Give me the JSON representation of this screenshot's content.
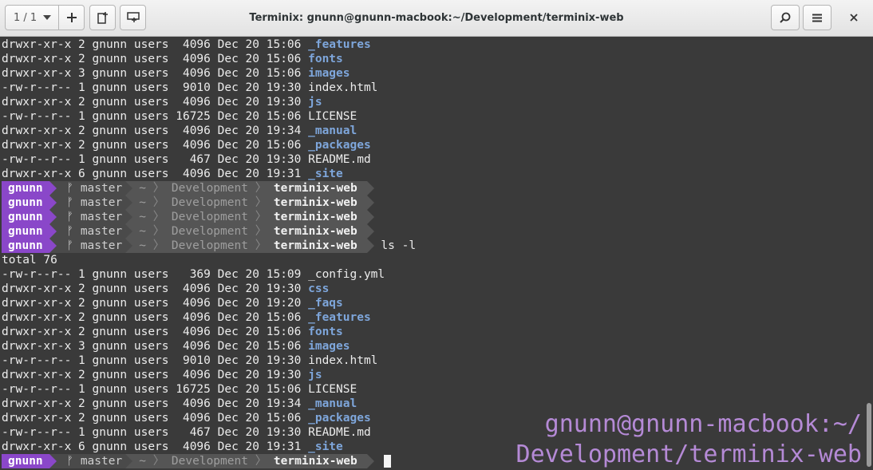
{
  "window": {
    "title": "Terminix: gnunn@gnunn-macbook:~/Development/terminix-web",
    "session_label": "1 / 1"
  },
  "icons": {
    "add": "plus-icon",
    "split_horizontal": "split-right-icon",
    "split_vertical": "split-down-icon",
    "find": "search-icon",
    "menu": "hamburger-icon",
    "close": "close-icon"
  },
  "colors": {
    "user_segment": "#8a47c9",
    "directory": "#7ea6db",
    "badge": "#b58ad6",
    "background": "#3a3a3a"
  },
  "prompt": {
    "user": "gnunn",
    "branch_icon": "ᚠ",
    "branch": "master",
    "home": "~",
    "dir1": "Development",
    "dir2": "terminix-web",
    "separator": "〉"
  },
  "terminal": {
    "lines_top": [
      {
        "meta": "drwxr-xr-x 2 gnunn users  4096 Dec 20 15:06 ",
        "name": "_features",
        "dir": true
      },
      {
        "meta": "drwxr-xr-x 2 gnunn users  4096 Dec 20 15:06 ",
        "name": "fonts",
        "dir": true
      },
      {
        "meta": "drwxr-xr-x 3 gnunn users  4096 Dec 20 15:06 ",
        "name": "images",
        "dir": true
      },
      {
        "meta": "-rw-r--r-- 1 gnunn users  9010 Dec 20 19:30 ",
        "name": "index.html",
        "dir": false
      },
      {
        "meta": "drwxr-xr-x 2 gnunn users  4096 Dec 20 19:30 ",
        "name": "js",
        "dir": true
      },
      {
        "meta": "-rw-r--r-- 1 gnunn users 16725 Dec 20 15:06 ",
        "name": "LICENSE",
        "dir": false
      },
      {
        "meta": "drwxr-xr-x 2 gnunn users  4096 Dec 20 19:34 ",
        "name": "_manual",
        "dir": true
      },
      {
        "meta": "drwxr-xr-x 2 gnunn users  4096 Dec 20 15:06 ",
        "name": "_packages",
        "dir": true
      },
      {
        "meta": "-rw-r--r-- 1 gnunn users   467 Dec 20 19:30 ",
        "name": "README.md",
        "dir": false
      },
      {
        "meta": "drwxr-xr-x 6 gnunn users  4096 Dec 20 19:31 ",
        "name": "_site",
        "dir": true
      }
    ],
    "empty_prompts": 4,
    "command": "ls -l",
    "total": "total 76",
    "lines_bottom": [
      {
        "meta": "-rw-r--r-- 1 gnunn users   369 Dec 20 15:09 ",
        "name": "_config.yml",
        "dir": false
      },
      {
        "meta": "drwxr-xr-x 2 gnunn users  4096 Dec 20 19:30 ",
        "name": "css",
        "dir": true
      },
      {
        "meta": "drwxr-xr-x 2 gnunn users  4096 Dec 20 19:20 ",
        "name": "_faqs",
        "dir": true
      },
      {
        "meta": "drwxr-xr-x 2 gnunn users  4096 Dec 20 15:06 ",
        "name": "_features",
        "dir": true
      },
      {
        "meta": "drwxr-xr-x 2 gnunn users  4096 Dec 20 15:06 ",
        "name": "fonts",
        "dir": true
      },
      {
        "meta": "drwxr-xr-x 3 gnunn users  4096 Dec 20 15:06 ",
        "name": "images",
        "dir": true
      },
      {
        "meta": "-rw-r--r-- 1 gnunn users  9010 Dec 20 19:30 ",
        "name": "index.html",
        "dir": false
      },
      {
        "meta": "drwxr-xr-x 2 gnunn users  4096 Dec 20 19:30 ",
        "name": "js",
        "dir": true
      },
      {
        "meta": "-rw-r--r-- 1 gnunn users 16725 Dec 20 15:06 ",
        "name": "LICENSE",
        "dir": false
      },
      {
        "meta": "drwxr-xr-x 2 gnunn users  4096 Dec 20 19:34 ",
        "name": "_manual",
        "dir": true
      },
      {
        "meta": "drwxr-xr-x 2 gnunn users  4096 Dec 20 15:06 ",
        "name": "_packages",
        "dir": true
      },
      {
        "meta": "-rw-r--r-- 1 gnunn users   467 Dec 20 19:30 ",
        "name": "README.md",
        "dir": false
      },
      {
        "meta": "drwxr-xr-x 6 gnunn users  4096 Dec 20 19:31 ",
        "name": "_site",
        "dir": true
      }
    ]
  },
  "badge": {
    "line1": "gnunn@gnunn-macbook:~/",
    "line2": "Development/terminix-web"
  }
}
